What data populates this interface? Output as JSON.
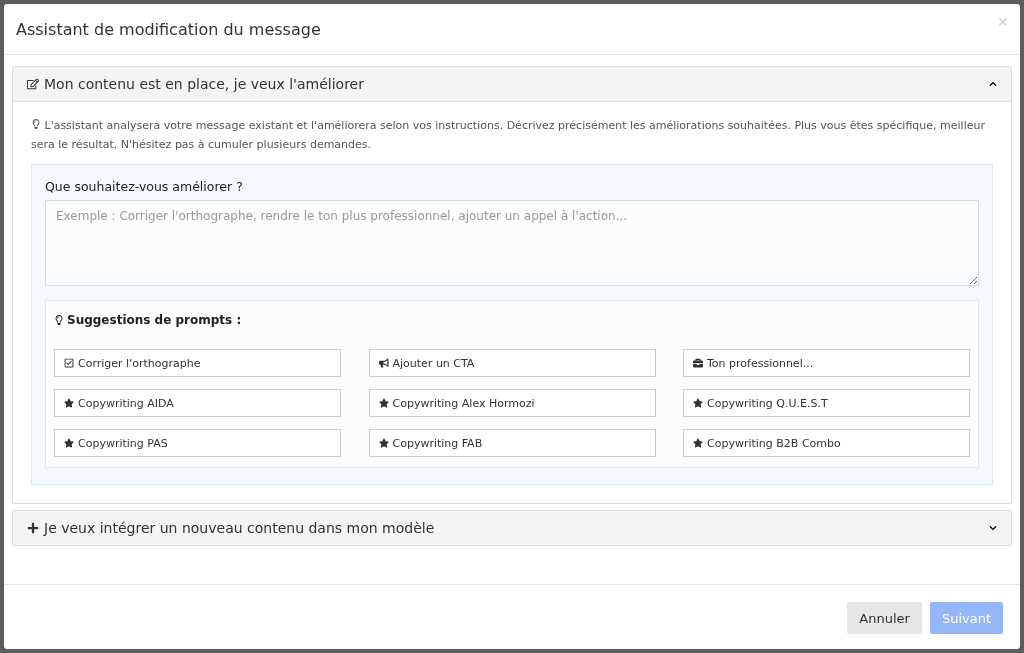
{
  "dialog": {
    "title": "Assistant de modification du message",
    "close": "×"
  },
  "sections": [
    {
      "kind": "edit",
      "title": "Mon contenu est en place, je veux l'améliorer",
      "expanded": true,
      "intro": "L'assistant analysera votre message existant et l'améliorera selon vos instructions. Décrivez précisément les améliorations souhaitées. Plus vous êtes spécifique, meilleur sera le résultat. N'hésitez pas à cumuler plusieurs demandes.",
      "field": {
        "label": "Que souhaitez-vous améliorer ?",
        "placeholder": "Exemple : Corriger l'orthographe, rendre le ton plus professionnel, ajouter un appel à l'action..."
      },
      "suggestions_title": "Suggestions de prompts :",
      "prompts": [
        {
          "kind": "check",
          "label": "Corriger l'orthographe"
        },
        {
          "kind": "megaphone",
          "label": "Ajouter un CTA"
        },
        {
          "kind": "briefcase",
          "label": "Ton professionnel..."
        },
        {
          "kind": "star",
          "label": "Copywriting AIDA"
        },
        {
          "kind": "star",
          "label": "Copywriting Alex Hormozi"
        },
        {
          "kind": "star",
          "label": "Copywriting Q.U.E.S.T"
        },
        {
          "kind": "star",
          "label": "Copywriting PAS"
        },
        {
          "kind": "star",
          "label": "Copywriting FAB"
        },
        {
          "kind": "star",
          "label": "Copywriting B2B Combo"
        }
      ]
    },
    {
      "kind": "plus",
      "title": "Je veux intégrer un nouveau contenu dans mon modèle",
      "expanded": false
    }
  ],
  "buttons": [
    {
      "label": "Annuler",
      "kind": "secondary",
      "disabled": false
    },
    {
      "label": "Suivant",
      "kind": "primary",
      "disabled": true
    }
  ]
}
